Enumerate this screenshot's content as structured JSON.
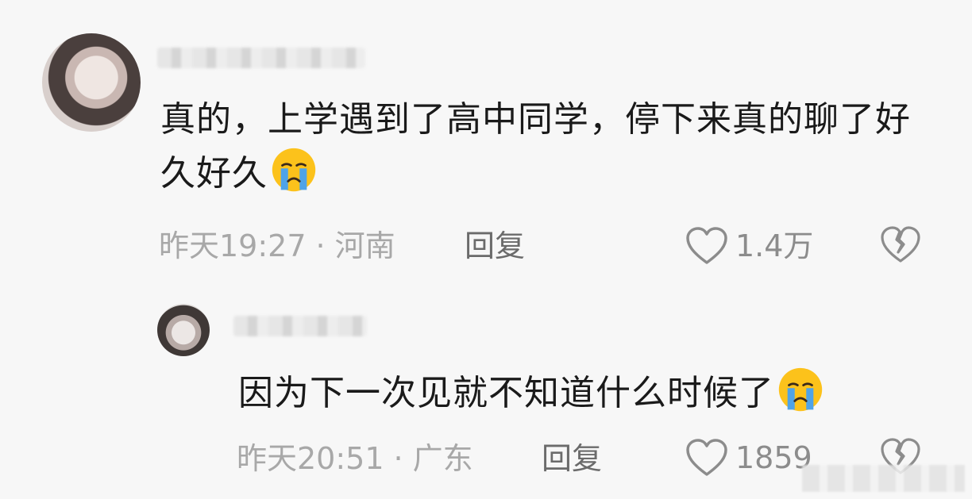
{
  "comment": {
    "text": "真的，上学遇到了高中同学，停下来真的聊了好久好久",
    "time": "昨天19:27",
    "location": "河南",
    "reply_label": "回复",
    "likes": "1.4万",
    "emoji_icon": "crying-face-emoji"
  },
  "reply": {
    "text": "因为下一次见就不知道什么时候了",
    "time": "昨天20:51",
    "location": "广东",
    "reply_label": "回复",
    "likes": "1859",
    "emoji_icon": "crying-face-emoji"
  },
  "separator": "·",
  "colors": {
    "background": "#f7f7f7",
    "text": "#1a1a1a",
    "meta": "#a8a8a8",
    "icon": "#8c8c8c"
  }
}
